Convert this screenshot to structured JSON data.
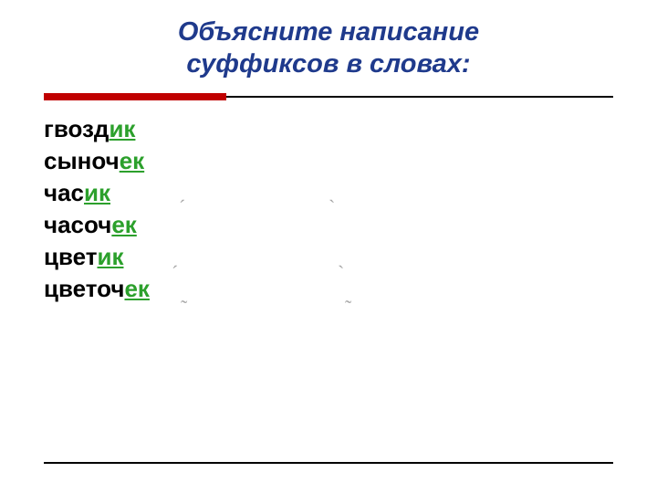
{
  "title_line1": "Объясните написание",
  "title_line2": "суффиксов в словах:",
  "words": [
    {
      "root": "гвозд",
      "suffix": "ик"
    },
    {
      "root": "сыноч",
      "suffix": "ек"
    },
    {
      "root": "час",
      "suffix": "ик"
    },
    {
      "root": "часоч",
      "suffix": "ек"
    },
    {
      "root": "цвет",
      "suffix": "ик"
    },
    {
      "root": "цветоч",
      "suffix": "ек"
    }
  ],
  "accents": {
    "a1": "´",
    "a2": "`",
    "a3": "´",
    "a4": "`",
    "a5": "˜",
    "a6": "˜"
  },
  "colors": {
    "title": "#1f3a8c",
    "rule_accent": "#c00000",
    "suffix": "#2ca02c"
  }
}
